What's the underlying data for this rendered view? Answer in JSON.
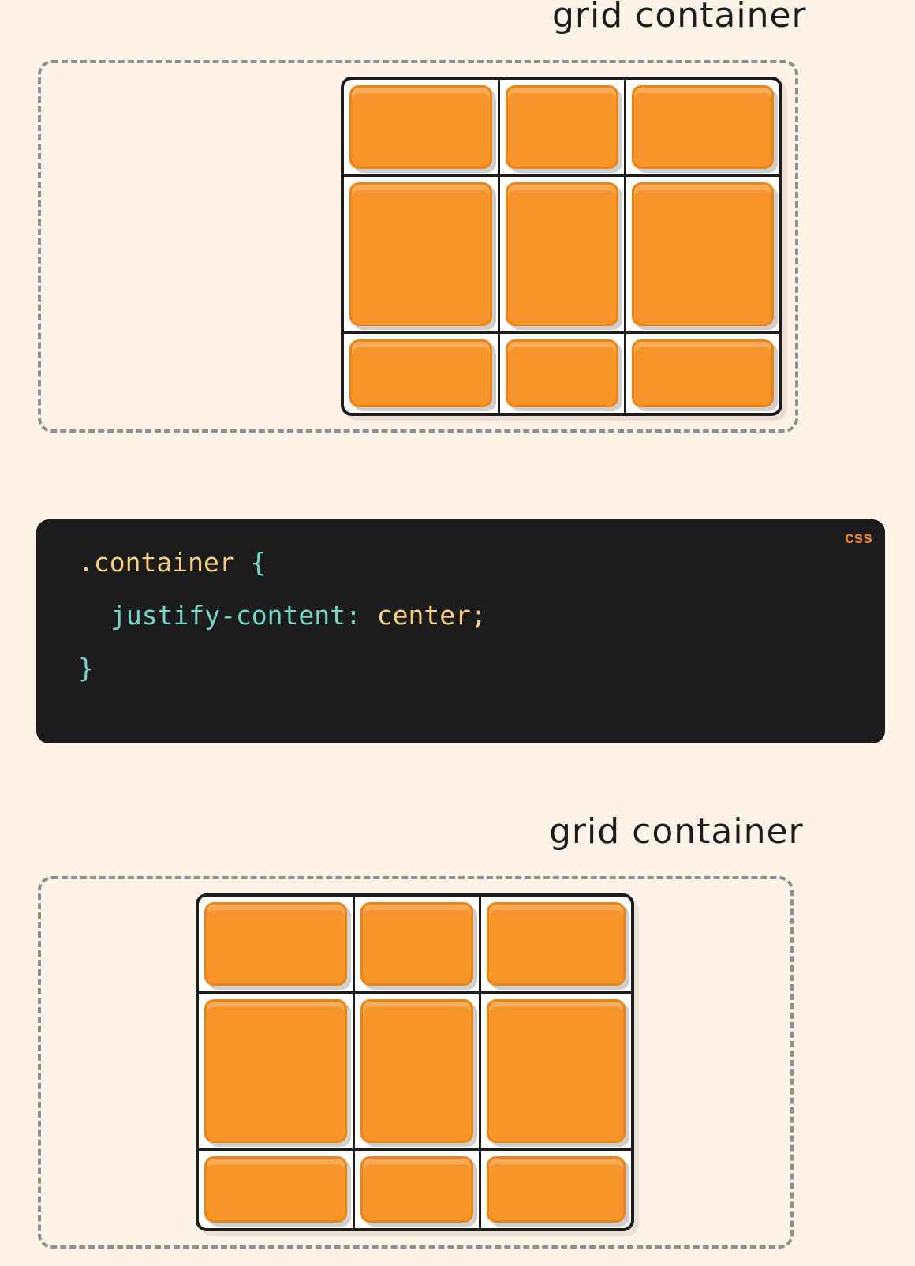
{
  "top_example": {
    "label": "grid container"
  },
  "code_block": {
    "language": "css",
    "selector": ".container",
    "open_brace": "{",
    "property": "justify-content",
    "colon": ":",
    "value": "center",
    "semicolon": ";",
    "close_brace": "}"
  },
  "bottom_example": {
    "label": "grid container"
  },
  "colors": {
    "background": "#fff3e7",
    "item_fill": "#f7952b",
    "item_border": "#ef8414",
    "grid_lines": "#1c1c1c",
    "dashed_border": "#8f8f8f",
    "code_background": "#1c1c1c",
    "code_selector": "#f5cf7d",
    "code_property": "#71d6c9",
    "code_value": "#f5cf7d",
    "code_language": "#f2872a"
  }
}
